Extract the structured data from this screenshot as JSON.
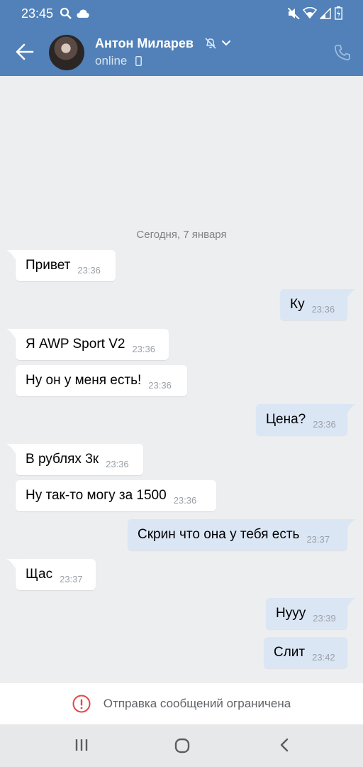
{
  "status": {
    "time": "23:45"
  },
  "header": {
    "name": "Антон Миларев",
    "presence": "online"
  },
  "chat": {
    "date": "Сегодня, 7 января",
    "messages": [
      {
        "dir": "in",
        "text": "Привет",
        "time": "23:36"
      },
      {
        "dir": "out",
        "text": "Ку",
        "time": "23:36"
      },
      {
        "dir": "in",
        "text": "Я AWP Sport V2",
        "time": "23:36"
      },
      {
        "dir": "in",
        "text": "Ну он у меня есть!",
        "time": "23:36"
      },
      {
        "dir": "out",
        "text": "Цена?",
        "time": "23:36"
      },
      {
        "dir": "in",
        "text": "В рублях 3к",
        "time": "23:36"
      },
      {
        "dir": "in",
        "text": "Ну так-то могу за 1500",
        "time": "23:36"
      },
      {
        "dir": "out",
        "text": "Скрин что она у тебя есть",
        "time": "23:37"
      },
      {
        "dir": "in",
        "text": "Щас",
        "time": "23:37"
      },
      {
        "dir": "out",
        "text": "Нууу",
        "time": "23:39"
      },
      {
        "dir": "out",
        "text": "Слит",
        "time": "23:42"
      }
    ]
  },
  "footer": {
    "restriction": "Отправка сообщений ограничена"
  },
  "colors": {
    "header": "#5181b8",
    "background": "#edeef0",
    "outgoing": "#dbe6f5",
    "incoming": "#ffffff",
    "alert": "#e64646"
  },
  "icons": [
    "search-icon",
    "cloud-icon",
    "mute-icon",
    "wifi-icon",
    "signal-icon",
    "battery-icon",
    "back-arrow-icon",
    "muted-bell-icon",
    "chevron-down-icon",
    "mobile-phone-icon",
    "call-icon",
    "alert-icon",
    "recent-apps-icon",
    "home-icon",
    "back-nav-icon"
  ]
}
